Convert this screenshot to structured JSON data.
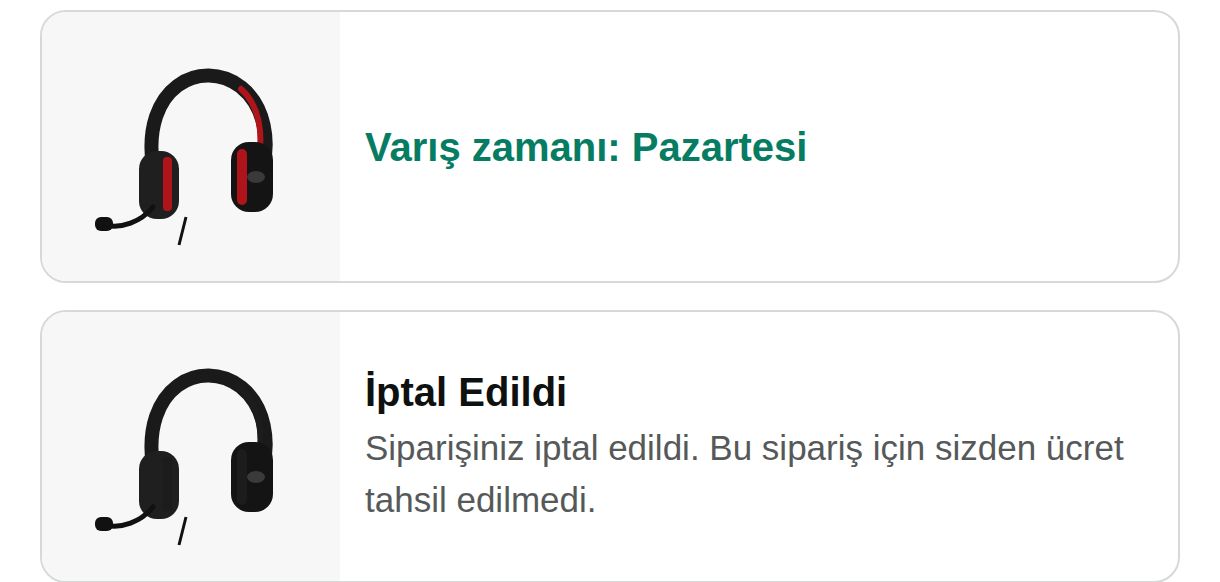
{
  "orders": [
    {
      "kind": "arrival",
      "title": "Varış zamanı: Pazartesi",
      "description": "",
      "color": "#b0141b"
    },
    {
      "kind": "cancelled",
      "title": "İptal Edildi",
      "description": "Siparişiniz iptal edildi. Bu sipariş için sizden ücret tahsil edilmedi.",
      "color": "#1c1c1c"
    }
  ]
}
